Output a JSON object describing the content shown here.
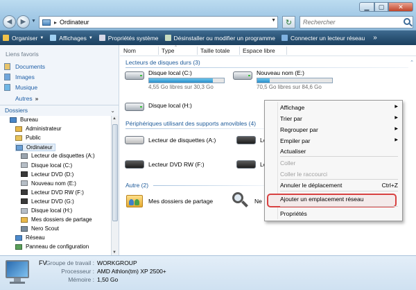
{
  "window": {
    "address_path": "Ordinateur",
    "search_placeholder": "Rechercher",
    "buttons": {
      "minimize": "▁",
      "maximize": "▢",
      "close": "✕"
    }
  },
  "toolbar": {
    "items": [
      {
        "label": "Organiser",
        "has_dropdown": true,
        "icon": "organize-icon",
        "color": "#f0c24a"
      },
      {
        "label": "Affichages",
        "has_dropdown": true,
        "icon": "views-icon",
        "color": "#9fd0f2"
      },
      {
        "label": "Propriétés système",
        "has_dropdown": false,
        "icon": "system-properties-icon",
        "color": "#d8d8e8"
      },
      {
        "label": "Désinstaller ou modifier un programme",
        "has_dropdown": false,
        "icon": "uninstall-icon",
        "color": "#c8dcc0"
      },
      {
        "label": "Connecter un lecteur réseau",
        "has_dropdown": false,
        "icon": "network-drive-icon",
        "color": "#7fb1e0"
      }
    ],
    "more": "»"
  },
  "sidebar": {
    "favorites_title": "Liens favoris",
    "favorites": [
      {
        "label": "Documents",
        "icon": "documents-icon"
      },
      {
        "label": "Images",
        "icon": "pictures-icon"
      },
      {
        "label": "Musique",
        "icon": "music-icon"
      }
    ],
    "more_label": "Autres",
    "more_chevron": "»",
    "folders_title": "Dossiers",
    "tree": [
      {
        "label": "Bureau",
        "indent": 0,
        "icon": "desktop-icon"
      },
      {
        "label": "Administrateur",
        "indent": 1,
        "icon": "user-folder-icon"
      },
      {
        "label": "Public",
        "indent": 1,
        "icon": "folder-icon"
      },
      {
        "label": "Ordinateur",
        "indent": 1,
        "icon": "computer-icon",
        "selected": true
      },
      {
        "label": "Lecteur de disquettes (A:)",
        "indent": 2,
        "icon": "floppy-drive-icon"
      },
      {
        "label": "Disque local (C:)",
        "indent": 2,
        "icon": "hard-disk-icon"
      },
      {
        "label": "Lecteur DVD (D:)",
        "indent": 2,
        "icon": "dvd-drive-icon"
      },
      {
        "label": "Nouveau nom (E:)",
        "indent": 2,
        "icon": "hard-disk-icon"
      },
      {
        "label": "Lecteur DVD RW (F:)",
        "indent": 2,
        "icon": "dvd-drive-icon"
      },
      {
        "label": "Lecteur DVD (G:)",
        "indent": 2,
        "icon": "dvd-drive-icon"
      },
      {
        "label": "Disque local (H:)",
        "indent": 2,
        "icon": "hard-disk-icon"
      },
      {
        "label": "Mes dossiers de partage",
        "indent": 2,
        "icon": "shared-folder-icon"
      },
      {
        "label": "Nero Scout",
        "indent": 2,
        "icon": "nero-scout-icon"
      },
      {
        "label": "Réseau",
        "indent": 1,
        "icon": "network-icon"
      },
      {
        "label": "Panneau de configuration",
        "indent": 1,
        "icon": "control-panel-icon"
      }
    ]
  },
  "columns": [
    "Nom",
    "Type",
    "Taille totale",
    "Espace libre"
  ],
  "groups": {
    "hard_disks": {
      "title": "Lecteurs de disques durs (3)",
      "items": [
        {
          "name": "Disque local (C:)",
          "free_text": "4,55 Go libres sur 30,3 Go",
          "used_fraction": 0.85
        },
        {
          "name": "Nouveau nom (E:)",
          "free_text": "70,5 Go libres sur 84,6 Go",
          "used_fraction": 0.17
        },
        {
          "name": "Disque local (H:)"
        }
      ]
    },
    "removable": {
      "title": "Périphériques utilisant des supports amovibles (4)",
      "items": [
        {
          "name": "Lecteur de disquettes (A:)"
        },
        {
          "name": "Le"
        },
        {
          "name": "Lecteur DVD RW (F:)"
        },
        {
          "name": "Le"
        }
      ]
    },
    "other": {
      "title": "Autre (2)",
      "items": [
        {
          "name": "Mes dossiers de partage"
        },
        {
          "name": "Ne"
        }
      ]
    }
  },
  "context_menu": {
    "items": [
      {
        "label": "Affichage",
        "submenu": true
      },
      {
        "label": "Trier par",
        "submenu": true
      },
      {
        "label": "Regrouper par",
        "submenu": true
      },
      {
        "label": "Empiler par",
        "submenu": true
      },
      {
        "label": "Actualiser"
      },
      {
        "label": "Coller",
        "disabled": true
      },
      {
        "label": "Coller le raccourci",
        "disabled": true
      },
      {
        "label": "Annuler le déplacement",
        "shortcut": "Ctrl+Z"
      },
      {
        "label": "Ajouter un emplacement réseau",
        "highlighted": true
      },
      {
        "label": "Propriétés"
      }
    ],
    "highlight_color": "#d84040"
  },
  "details": {
    "name": "FV",
    "rows": [
      {
        "label": "Groupe de travail :",
        "value": "WORKGROUP"
      },
      {
        "label": "Processeur :",
        "value": "AMD Athlon(tm) XP 2500+"
      },
      {
        "label": "Mémoire :",
        "value": "1,50 Go"
      }
    ]
  }
}
